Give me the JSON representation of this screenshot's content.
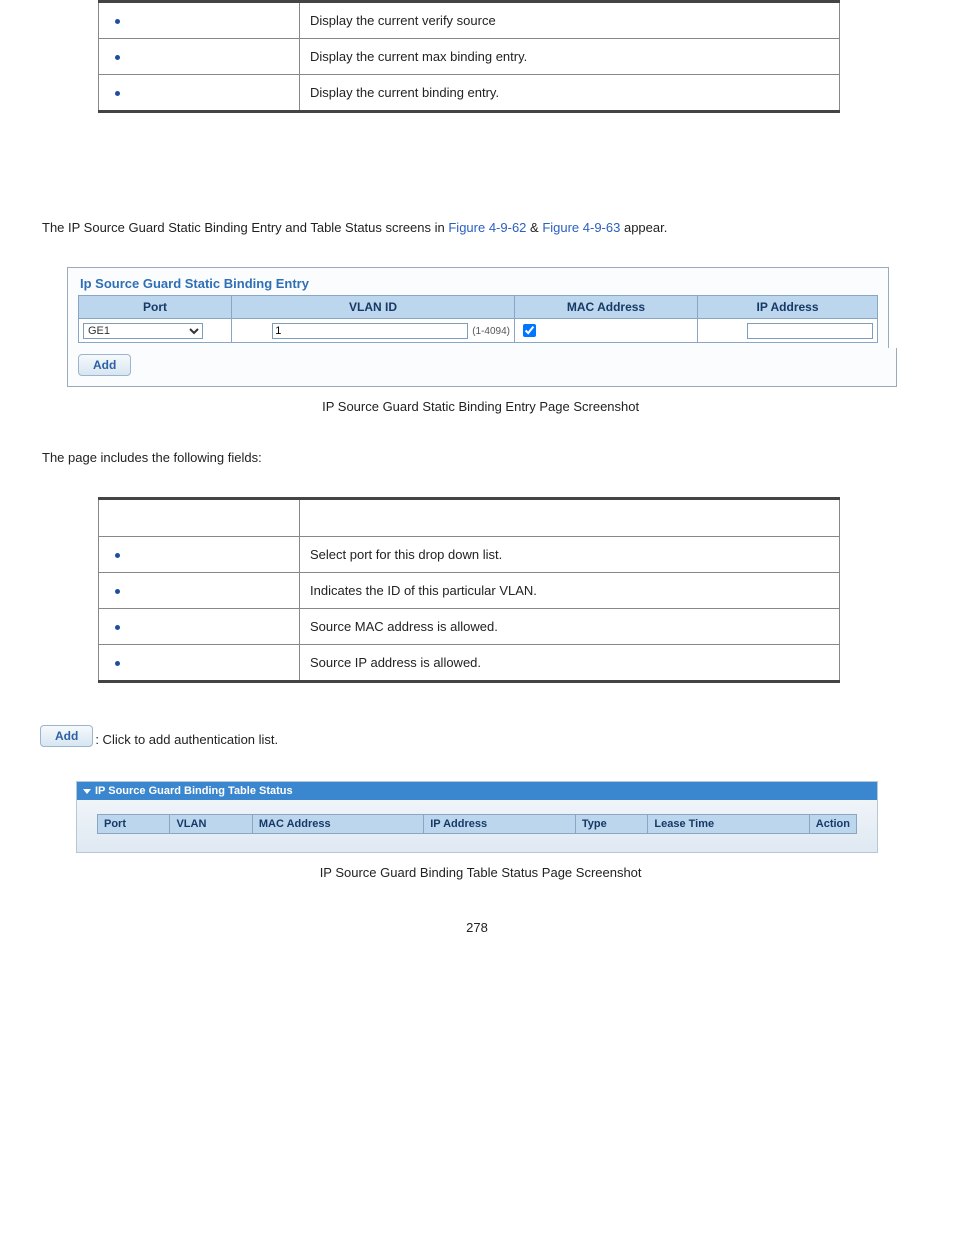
{
  "table1": {
    "row1_desc": "Display the current verify source",
    "row2_desc": "Display the current max binding entry.",
    "row3_desc": "Display the current binding entry."
  },
  "intro": {
    "prefix": "The IP Source Guard Static Binding Entry and Table Status screens in ",
    "link1": "Figure 4-9-62",
    "amp": " & ",
    "link2": "Figure 4-9-63",
    "suffix": " appear."
  },
  "entryPanel": {
    "title": "Ip Source Guard Static Binding Entry",
    "headers": {
      "port": "Port",
      "vlan": "VLAN ID",
      "mac": "MAC Address",
      "ip": "IP Address"
    },
    "port_value": "GE1",
    "vlan_value": "1",
    "vlan_range": "(1-4094)",
    "addLabel": "Add"
  },
  "caption1": " IP Source Guard Static Binding Entry Page Screenshot",
  "fieldsIntro": "The page includes the following fields:",
  "table2": {
    "port_desc": "Select port for this drop down list.",
    "vlan_desc": "Indicates the ID of this particular VLAN.",
    "mac_desc": "Source MAC address is allowed.",
    "ip_desc": "Source IP address is allowed."
  },
  "addDesc": ": Click to add authentication list.",
  "statusPanel": {
    "title": "IP Source Guard Binding Table Status",
    "headers": {
      "port": "Port",
      "vlan": "VLAN",
      "mac": "MAC Address",
      "ip": "IP Address",
      "type": "Type",
      "lease": "Lease Time",
      "action": "Action"
    }
  },
  "caption2": " IP Source Guard Binding Table Status Page Screenshot",
  "pageNum": "278"
}
